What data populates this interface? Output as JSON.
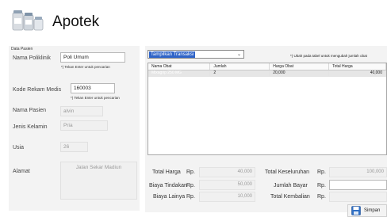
{
  "header": {
    "title": "Apotek"
  },
  "patient": {
    "caption": "Data Pasien",
    "poliklinik_label": "Nama Poliklinik",
    "poliklinik_value": "Poli Umum",
    "poliklinik_hint": "*) Tekan Enter untuk pencarian",
    "rekam_medis_label": "Kode Rekam Medis",
    "rekam_medis_value": "160003",
    "rekam_medis_hint": "*) Tekan Enter untuk pencarian",
    "nama_label": "Nama Pasien",
    "nama_value": "alvin",
    "kelamin_label": "Jenis Kelamin",
    "kelamin_value": "Pria",
    "usia_label": "Usia",
    "usia_value": "26",
    "alamat_label": "Alamat",
    "alamat_value": "Jalan Sekar Madiun"
  },
  "transactions": {
    "dropdown_value": "Tampilkan Transaksi",
    "note": "*) Ubah pada tabel untuk mengubah jumlah obat",
    "columns": [
      "Nama Obat",
      "Jumlah",
      "Harga Obat",
      "Total Harga"
    ],
    "rows": [
      {
        "nama": "Mixagrip 250 MG",
        "jumlah": "2",
        "harga": "20,000",
        "total": "40,000"
      }
    ]
  },
  "summary": {
    "currency": "Rp.",
    "total_harga_label": "Total Harga",
    "total_harga_value": "40,000",
    "tindakan_label": "Biaya Tindakan",
    "tindakan_value": "50,000",
    "lainya_label": "Biaya Lainya",
    "lainya_value": "10,000",
    "keseluruhan_label": "Total Keseluruhan",
    "keseluruhan_value": "100,000",
    "bayar_label": "Jumlah Bayar",
    "bayar_value": "",
    "kembalian_label": "Total Kembalian",
    "kembalian_value": ""
  },
  "actions": {
    "save_label": "Simpan"
  }
}
